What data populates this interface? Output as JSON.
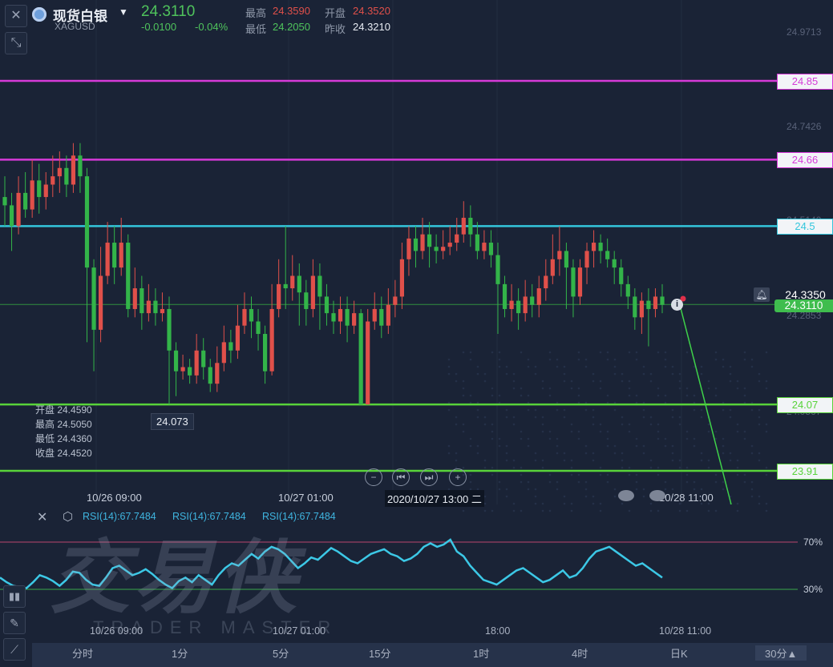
{
  "header": {
    "close_icon": "close-icon",
    "symbol_icon": "silver-coin-icon",
    "title": "现货白银",
    "subtitle": "XAGUSD",
    "last_price": "24.3110",
    "change": "-0.0100",
    "change_pct": "-0.04%",
    "high_label": "最高",
    "high": "24.3590",
    "open_label": "开盘",
    "open": "24.3520",
    "low_label": "最低",
    "low": "24.2050",
    "prev_close_label": "昨收",
    "prev_close": "24.3210"
  },
  "ohlc_box": {
    "open": "开盘 24.4590",
    "high": "最高 24.5050",
    "low": "最低 24.4360",
    "close": "收盘 24.4520"
  },
  "price_axis": {
    "top": "24.9713",
    "mid": "24.7426",
    "partial_1": "24.5140",
    "near": "24.2853",
    "partial_2": "24.0567"
  },
  "levels": [
    {
      "value": 24.85,
      "label": "24.85",
      "color": "#d63ad8"
    },
    {
      "value": 24.66,
      "label": "24.66",
      "color": "#d63ad8"
    },
    {
      "value": 24.5,
      "label": "24.5",
      "color": "#34c6dc"
    },
    {
      "value": 24.07,
      "label": "24.07",
      "color": "#58d33a"
    },
    {
      "value": 23.91,
      "label": "23.91",
      "color": "#58d33a"
    }
  ],
  "current_price_tag": "24.3110",
  "alert_price_tag": "24.3350",
  "low_marker": "24.073",
  "time_axis": {
    "t1": "10/26 09:00",
    "t2": "10/27 01:00",
    "t3": "2020/10/27 13:00 二",
    "t4": "10/28 11:00"
  },
  "rsi": {
    "labels": [
      "RSI(14):67.7484",
      "RSI(14):67.7484",
      "RSI(14):67.7484"
    ],
    "level_70": "70%",
    "level_30": "30%",
    "axis": {
      "t1": "10/26 09:00",
      "t2": "10/27 01:00",
      "t3": "18:00",
      "t4": "10/28 11:00"
    }
  },
  "watermark": {
    "cn": "交易侠",
    "en": "TRADER MASTER"
  },
  "timeframes": [
    "分时",
    "1分",
    "5分",
    "15分",
    "1时",
    "4时",
    "日K",
    "30分▲"
  ],
  "colors": {
    "up": "#e0504a",
    "down": "#33b449",
    "bg": "#1a2336",
    "rsi": "#3cc8e6"
  },
  "chart_data": {
    "type": "candlestick",
    "title": "现货白银 XAGUSD",
    "xlabel": "",
    "ylabel": "",
    "x_ticks": [
      "10/26 09:00",
      "10/27 01:00",
      "2020/10/27 13:00",
      "10/28 11:00"
    ],
    "ylim": [
      23.84,
      25.0
    ],
    "horizontal_levels": [
      24.85,
      24.66,
      24.5,
      24.07,
      23.91
    ],
    "last": 24.311,
    "candles": [
      [
        24.57,
        24.55,
        24.62,
        24.5
      ],
      [
        24.55,
        24.5,
        24.58,
        24.44
      ],
      [
        24.5,
        24.58,
        24.62,
        24.48
      ],
      [
        24.58,
        24.54,
        24.63,
        24.52
      ],
      [
        24.54,
        24.61,
        24.66,
        24.52
      ],
      [
        24.61,
        24.57,
        24.65,
        24.53
      ],
      [
        24.57,
        24.6,
        24.63,
        24.54
      ],
      [
        24.6,
        24.62,
        24.67,
        24.57
      ],
      [
        24.62,
        24.64,
        24.68,
        24.58
      ],
      [
        24.64,
        24.6,
        24.67,
        24.57
      ],
      [
        24.6,
        24.67,
        24.7,
        24.58
      ],
      [
        24.67,
        24.62,
        24.7,
        24.58
      ],
      [
        24.62,
        24.4,
        24.64,
        24.22
      ],
      [
        24.4,
        24.25,
        24.42,
        24.15
      ],
      [
        24.25,
        24.38,
        24.45,
        24.22
      ],
      [
        24.38,
        24.46,
        24.51,
        24.36
      ],
      [
        24.46,
        24.4,
        24.5,
        24.36
      ],
      [
        24.4,
        24.46,
        24.52,
        24.38
      ],
      [
        24.46,
        24.3,
        24.48,
        24.28
      ],
      [
        24.3,
        24.35,
        24.4,
        24.28
      ],
      [
        24.35,
        24.29,
        24.38,
        24.25
      ],
      [
        24.29,
        24.32,
        24.36,
        24.27
      ],
      [
        24.32,
        24.29,
        24.35,
        24.26
      ],
      [
        24.29,
        24.3,
        24.34,
        24.27
      ],
      [
        24.3,
        24.2,
        24.33,
        24.07
      ],
      [
        24.2,
        24.15,
        24.22,
        24.09
      ],
      [
        24.15,
        24.16,
        24.19,
        24.13
      ],
      [
        24.16,
        24.14,
        24.18,
        24.12
      ],
      [
        24.14,
        24.2,
        24.24,
        24.12
      ],
      [
        24.2,
        24.16,
        24.23,
        24.13
      ],
      [
        24.16,
        24.12,
        24.18,
        24.1
      ],
      [
        24.12,
        24.17,
        24.21,
        24.1
      ],
      [
        24.17,
        24.22,
        24.26,
        24.15
      ],
      [
        24.22,
        24.2,
        24.25,
        24.17
      ],
      [
        24.2,
        24.26,
        24.31,
        24.18
      ],
      [
        24.26,
        24.3,
        24.34,
        24.24
      ],
      [
        24.3,
        24.27,
        24.33,
        24.23
      ],
      [
        24.27,
        24.24,
        24.3,
        24.2
      ],
      [
        24.24,
        24.15,
        24.26,
        24.12
      ],
      [
        24.15,
        24.3,
        24.36,
        24.14
      ],
      [
        24.3,
        24.36,
        24.42,
        24.28
      ],
      [
        24.36,
        24.35,
        24.5,
        24.3
      ],
      [
        24.35,
        24.38,
        24.43,
        24.32
      ],
      [
        24.38,
        24.34,
        24.41,
        24.26
      ],
      [
        24.34,
        24.3,
        24.37,
        24.26
      ],
      [
        24.3,
        24.38,
        24.42,
        24.28
      ],
      [
        24.38,
        24.33,
        24.41,
        24.25
      ],
      [
        24.33,
        24.29,
        24.36,
        24.26
      ],
      [
        24.29,
        24.27,
        24.32,
        24.24
      ],
      [
        24.27,
        24.3,
        24.33,
        24.24
      ],
      [
        24.3,
        24.26,
        24.33,
        24.22
      ],
      [
        24.26,
        24.29,
        24.32,
        24.24
      ],
      [
        24.29,
        24.07,
        24.3,
        24.07
      ],
      [
        24.07,
        24.27,
        24.3,
        24.07
      ],
      [
        24.27,
        24.3,
        24.34,
        24.25
      ],
      [
        24.3,
        24.26,
        24.33,
        24.23
      ],
      [
        24.26,
        24.31,
        24.35,
        24.24
      ],
      [
        24.31,
        24.33,
        24.37,
        24.28
      ],
      [
        24.33,
        24.42,
        24.46,
        24.3
      ],
      [
        24.42,
        24.47,
        24.5,
        24.38
      ],
      [
        24.47,
        24.44,
        24.5,
        24.4
      ],
      [
        24.44,
        24.48,
        24.52,
        24.42
      ],
      [
        24.48,
        24.45,
        24.51,
        24.4
      ],
      [
        24.45,
        24.44,
        24.48,
        24.41
      ],
      [
        24.44,
        24.45,
        24.49,
        24.42
      ],
      [
        24.45,
        24.46,
        24.5,
        24.43
      ],
      [
        24.46,
        24.48,
        24.52,
        24.44
      ],
      [
        24.48,
        24.52,
        24.56,
        24.46
      ],
      [
        24.52,
        24.48,
        24.55,
        24.45
      ],
      [
        24.48,
        24.44,
        24.51,
        24.42
      ],
      [
        24.44,
        24.46,
        24.49,
        24.42
      ],
      [
        24.46,
        24.43,
        24.49,
        24.4
      ],
      [
        24.43,
        24.36,
        24.46,
        24.24
      ],
      [
        24.36,
        24.3,
        24.38,
        24.28
      ],
      [
        24.3,
        24.32,
        24.36,
        24.27
      ],
      [
        24.32,
        24.29,
        24.35,
        24.25
      ],
      [
        24.29,
        24.33,
        24.37,
        24.27
      ],
      [
        24.33,
        24.31,
        24.36,
        24.28
      ],
      [
        24.31,
        24.35,
        24.38,
        24.28
      ],
      [
        24.35,
        24.38,
        24.42,
        24.32
      ],
      [
        24.38,
        24.42,
        24.48,
        24.36
      ],
      [
        24.42,
        24.44,
        24.5,
        24.38
      ],
      [
        24.44,
        24.4,
        24.46,
        24.3
      ],
      [
        24.4,
        24.33,
        24.42,
        24.28
      ],
      [
        24.33,
        24.4,
        24.42,
        24.31
      ],
      [
        24.4,
        24.44,
        24.46,
        24.36
      ],
      [
        24.44,
        24.46,
        24.49,
        24.4
      ],
      [
        24.46,
        24.44,
        24.48,
        24.41
      ],
      [
        24.44,
        24.42,
        24.47,
        24.4
      ],
      [
        24.42,
        24.4,
        24.44,
        24.36
      ],
      [
        24.4,
        24.36,
        24.42,
        24.33
      ],
      [
        24.36,
        24.33,
        24.38,
        24.3
      ],
      [
        24.33,
        24.28,
        24.35,
        24.25
      ],
      [
        24.28,
        24.32,
        24.34,
        24.24
      ],
      [
        24.32,
        24.3,
        24.35,
        24.21
      ],
      [
        24.3,
        24.33,
        24.35,
        24.28
      ],
      [
        24.33,
        24.31,
        24.36,
        24.29
      ]
    ],
    "rsi_series": {
      "name": "RSI(14)",
      "ylim": [
        0,
        100
      ],
      "levels": [
        70,
        30
      ],
      "values": [
        40,
        36,
        33,
        32,
        31,
        36,
        42,
        40,
        37,
        33,
        38,
        45,
        44,
        38,
        34,
        33,
        40,
        48,
        50,
        46,
        42,
        44,
        47,
        43,
        38,
        34,
        31,
        37,
        40,
        36,
        42,
        38,
        34,
        42,
        48,
        52,
        50,
        55,
        60,
        56,
        62,
        66,
        64,
        60,
        54,
        48,
        52,
        57,
        55,
        60,
        65,
        62,
        58,
        54,
        52,
        56,
        60,
        62,
        64,
        60,
        58,
        54,
        56,
        60,
        66,
        69,
        66,
        68,
        72,
        62,
        58,
        50,
        44,
        38,
        36,
        34,
        38,
        42,
        46,
        48,
        44,
        40,
        36,
        38,
        42,
        46,
        40,
        42,
        48,
        56,
        62,
        64,
        66,
        62,
        58,
        54,
        50,
        52,
        48,
        44,
        40
      ]
    }
  }
}
